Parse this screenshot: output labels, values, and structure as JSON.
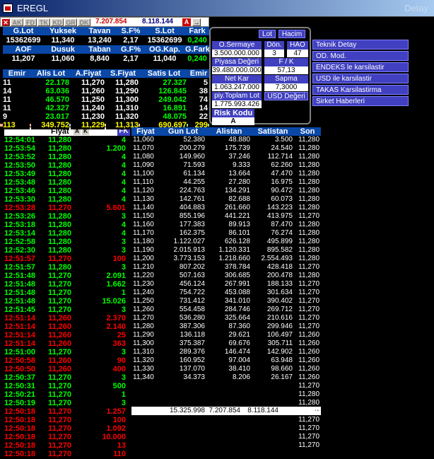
{
  "window": {
    "title": "EREGL",
    "detay": "Detay"
  },
  "toolbar": {
    "items": [
      "AK",
      "FD",
      "TK",
      "KD",
      "GR",
      "DK"
    ],
    "num1": "7.207.854",
    "num2": "8.118.144",
    "a_label": "A"
  },
  "summary": {
    "row1": {
      "headers": [
        "G.Lot",
        "Yuksek",
        "Tavan",
        "S.F%",
        "S.Lot",
        "Fark"
      ],
      "values": [
        "15362699",
        "11,340",
        "13,240",
        "2,17",
        "15362699",
        "0,240"
      ]
    },
    "row2": {
      "headers": [
        "AOF",
        "Dusuk",
        "Taban",
        "G.F%",
        "OG.Kap.",
        "G.Fark"
      ],
      "values": [
        "11,207",
        "11,060",
        "8,840",
        "2,17",
        "11,040",
        "0,240"
      ]
    }
  },
  "depth": {
    "headers": [
      "Emir",
      "Alis Lot",
      "A.Fiyat",
      "S.Fiyat",
      "Satis Lot",
      "Emir"
    ],
    "rows": [
      [
        "11",
        "22.178",
        "11,270",
        "11,280",
        "27.327",
        "5"
      ],
      [
        "14",
        "63.036",
        "11,260",
        "11,290",
        "126.845",
        "38"
      ],
      [
        "11",
        "46.570",
        "11,250",
        "11,300",
        "249.042",
        "74"
      ],
      [
        "11",
        "42.327",
        "11,240",
        "11,310",
        "16.891",
        "14"
      ],
      [
        "9",
        "23.017",
        "11,230",
        "11,320",
        "48.075",
        "22"
      ]
    ],
    "total": [
      "113",
      "349.752",
      "11,229",
      "11,313",
      "690.697",
      "299"
    ]
  },
  "info_panel": {
    "lot_btn": "Lot",
    "hacim_btn": "Hacim",
    "o_sermaye_label": "O.Sermaye",
    "o_sermaye": "3.500.000.000",
    "don_label": "Dön.",
    "don": "3",
    "hao_label": "HAO",
    "hao": "47",
    "piyasa_label": "Piyasa Değeri",
    "piyasa": "39.480.000.000",
    "fk_label": "F / K",
    "fk": "57,13",
    "netkar_label": "Net Kar",
    "netkar": "1.063.247.000",
    "sapma_label": "Sapma",
    "sapma": "7,3000",
    "piytop_label": "piy.Toplam Lot",
    "piytop": "1.775.993.426",
    "usd_label": "USD Değeri",
    "risk_label": "Risk Kodu",
    "risk": "A"
  },
  "menu": [
    "Teknik Detay",
    "OD. Mod.",
    "ENDEKS le karsilastir",
    "USD ile karsilastir",
    "TAKAS Karsilastirma",
    "Sirket Haberleri"
  ],
  "trades": {
    "col_fiyat": "Fiyat",
    "badges": [
      "A",
      "K"
    ],
    "fk": "FK",
    "rows": [
      [
        "12:54:01",
        "11,280",
        "4",
        "g"
      ],
      [
        "12:53:54",
        "11,280",
        "1.200",
        "g"
      ],
      [
        "12:53:52",
        "11,280",
        "4",
        "g"
      ],
      [
        "12:53:50",
        "11,280",
        "4",
        "g"
      ],
      [
        "12:53:49",
        "11,280",
        "4",
        "g"
      ],
      [
        "12:53:48",
        "11,280",
        "4",
        "g"
      ],
      [
        "12:53:46",
        "11,280",
        "4",
        "g"
      ],
      [
        "12:53:30",
        "11,280",
        "4",
        "g"
      ],
      [
        "12:53:28",
        "11,270",
        "5.601",
        "r"
      ],
      [
        "12:53:26",
        "11,280",
        "3",
        "g"
      ],
      [
        "12:53:18",
        "11,280",
        "4",
        "g"
      ],
      [
        "12:53:14",
        "11,280",
        "4",
        "g"
      ],
      [
        "12:52:58",
        "11,280",
        "3",
        "g"
      ],
      [
        "12:52:30",
        "11,280",
        "3",
        "g"
      ],
      [
        "12:51:57",
        "11,270",
        "100",
        "r"
      ],
      [
        "12:51:57",
        "11,280",
        "3",
        "g"
      ],
      [
        "12:51:48",
        "11,270",
        "2.091",
        "g"
      ],
      [
        "12:51:48",
        "11,270",
        "1.662",
        "g"
      ],
      [
        "12:51:48",
        "11,270",
        "1",
        "g"
      ],
      [
        "12:51:48",
        "11,270",
        "15.026",
        "g"
      ],
      [
        "12:51:45",
        "11,270",
        "3",
        "g"
      ],
      [
        "12:51:14",
        "11,260",
        "2.370",
        "r"
      ],
      [
        "12:51:14",
        "11,260",
        "2.140",
        "r"
      ],
      [
        "12:51:14",
        "11,260",
        "25",
        "r"
      ],
      [
        "12:51:14",
        "11,260",
        "363",
        "r"
      ],
      [
        "12:51:00",
        "11,270",
        "3",
        "g"
      ],
      [
        "12:50:58",
        "11,260",
        "90",
        "r"
      ],
      [
        "12:50:50",
        "11,260",
        "400",
        "r"
      ],
      [
        "12:50:37",
        "11,270",
        "3",
        "g"
      ],
      [
        "12:50:31",
        "11,270",
        "500",
        "g"
      ],
      [
        "12:50:21",
        "11,270",
        "1",
        "g"
      ],
      [
        "12:50:19",
        "11,270",
        "3",
        "g"
      ],
      [
        "12:50:18",
        "11,270",
        "1.257",
        "r"
      ],
      [
        "12:50:18",
        "11,270",
        "100",
        "r"
      ],
      [
        "12:50:18",
        "11,270",
        "1.092",
        "r"
      ],
      [
        "12:50:18",
        "11,270",
        "10.000",
        "r"
      ],
      [
        "12:50:18",
        "11,270",
        "13",
        "r"
      ],
      [
        "12:50:18",
        "11,270",
        "110",
        "r"
      ]
    ]
  },
  "price_table": {
    "headers": [
      "Fiyat",
      "Gun Lot",
      "Alistan",
      "Satistan",
      "Son"
    ],
    "rows": [
      [
        "11,060",
        "52.380",
        "48.880",
        "3.500",
        "11,280"
      ],
      [
        "11,070",
        "200.279",
        "175.739",
        "24.540",
        "11,280"
      ],
      [
        "11,080",
        "149.960",
        "37.246",
        "112.714",
        "11,280"
      ],
      [
        "11,090",
        "71.593",
        "9.333",
        "62.260",
        "11,280"
      ],
      [
        "11,100",
        "61.134",
        "13.664",
        "47.470",
        "11,280"
      ],
      [
        "11,110",
        "44.255",
        "27.280",
        "16.975",
        "11,280"
      ],
      [
        "11,120",
        "224.763",
        "134.291",
        "90.472",
        "11,280"
      ],
      [
        "11,130",
        "142.761",
        "82.688",
        "60.073",
        "11,280"
      ],
      [
        "11,140",
        "404.883",
        "261.660",
        "143.223",
        "11,280"
      ],
      [
        "11,150",
        "855.196",
        "441.221",
        "413.975",
        "11,270"
      ],
      [
        "11,160",
        "177.383",
        "89.913",
        "87.470",
        "11,280"
      ],
      [
        "11,170",
        "162.375",
        "86.101",
        "76.274",
        "11,280"
      ],
      [
        "11,180",
        "1.122.027",
        "626.128",
        "495.899",
        "11,280"
      ],
      [
        "11,190",
        "2.015.913",
        "1.120.331",
        "895.582",
        "11,280"
      ],
      [
        "11,200",
        "3.773.153",
        "1.218.660",
        "2.554.493",
        "11,280"
      ],
      [
        "11,210",
        "807.202",
        "378.784",
        "428.418",
        "11,270"
      ],
      [
        "11,220",
        "507.163",
        "306.685",
        "200.478",
        "11,280"
      ],
      [
        "11,230",
        "456.124",
        "267.991",
        "188.133",
        "11,270"
      ],
      [
        "11,240",
        "754.722",
        "453.088",
        "301.634",
        "11,270"
      ],
      [
        "11,250",
        "731.412",
        "341.010",
        "390.402",
        "11,270"
      ],
      [
        "11,260",
        "554.458",
        "284.746",
        "269.712",
        "11,270"
      ],
      [
        "11,270",
        "536.280",
        "325.664",
        "210.616",
        "11,270"
      ],
      [
        "11,280",
        "387.306",
        "87.360",
        "299.946",
        "11,270"
      ],
      [
        "11,290",
        "136.118",
        "29.621",
        "106.497",
        "11,260"
      ],
      [
        "11,300",
        "375.387",
        "69.676",
        "305.711",
        "11,260"
      ],
      [
        "11,310",
        "289.376",
        "146.474",
        "142.902",
        "11,260"
      ],
      [
        "11,320",
        "160.952",
        "97.004",
        "63.948",
        "11,260"
      ],
      [
        "11,330",
        "137.070",
        "38.410",
        "98.660",
        "11,260"
      ],
      [
        "11,340",
        "34.373",
        "8.206",
        "26.167",
        "11,260"
      ]
    ],
    "extra_son": [
      "11,270",
      "11,280",
      "11,280",
      "11,280",
      "11,270",
      "11,270",
      "11,270",
      "11,270"
    ],
    "total": [
      "15.325.998",
      "7.207.854",
      "8.118.144",
      "--"
    ]
  }
}
